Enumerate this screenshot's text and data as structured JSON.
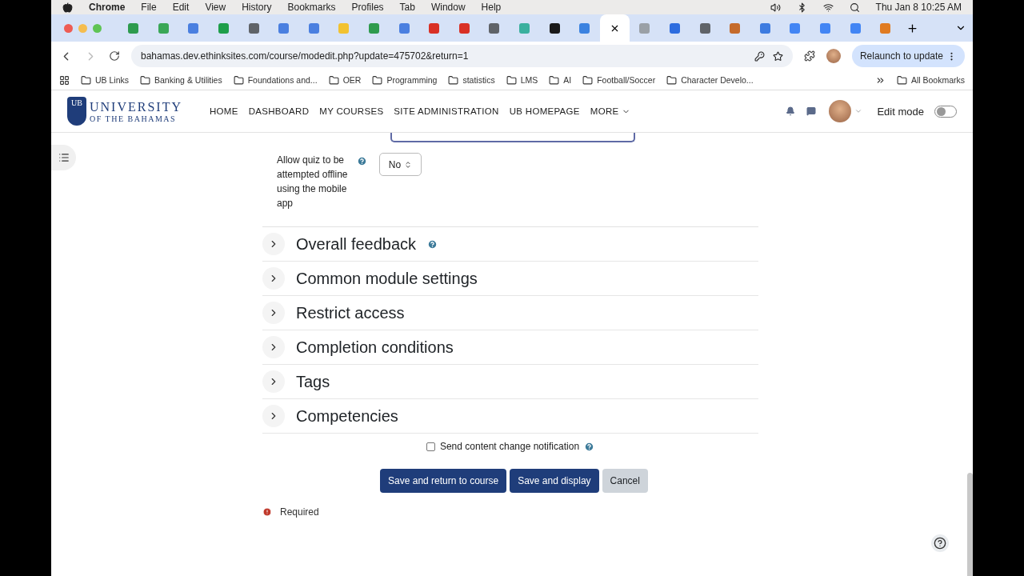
{
  "menu_bar": {
    "app": "Chrome",
    "items": [
      "File",
      "Edit",
      "View",
      "History",
      "Bookmarks",
      "Profiles",
      "Tab",
      "Window",
      "Help"
    ],
    "clock": "Thu Jan 8  10:25 AM"
  },
  "tabs": [
    {
      "selected": false,
      "color": "#2e9b4e"
    },
    {
      "selected": false,
      "color": "#3aa757"
    },
    {
      "selected": false,
      "color": "#4a7fe0"
    },
    {
      "selected": false,
      "color": "#1e9e4a"
    },
    {
      "selected": false,
      "color": "#5f6368"
    },
    {
      "selected": false,
      "color": "#4a7fe0"
    },
    {
      "selected": false,
      "color": "#4a7fe0"
    },
    {
      "selected": false,
      "color": "#f2c230"
    },
    {
      "selected": false,
      "color": "#2e9b4e"
    },
    {
      "selected": false,
      "color": "#4a7fe0"
    },
    {
      "selected": false,
      "color": "#d93025"
    },
    {
      "selected": false,
      "color": "#d93025"
    },
    {
      "selected": false,
      "color": "#5f6368"
    },
    {
      "selected": false,
      "color": "#3ab09e"
    },
    {
      "selected": false,
      "color": "#1a1a1a"
    },
    {
      "selected": false,
      "color": "#3b82e0"
    },
    {
      "selected": true
    },
    {
      "selected": false,
      "color": "#9aa0a6"
    },
    {
      "selected": false,
      "color": "#2d6cdf"
    },
    {
      "selected": false,
      "color": "#5f6368"
    },
    {
      "selected": false,
      "color": "#c56a2a"
    },
    {
      "selected": false,
      "color": "#3d7be0"
    },
    {
      "selected": false,
      "color": "#4285f4"
    },
    {
      "selected": false,
      "color": "#4285f4"
    },
    {
      "selected": false,
      "color": "#4285f4"
    },
    {
      "selected": false,
      "color": "#e07b22"
    }
  ],
  "address_bar": {
    "url": "bahamas.dev.ethinksites.com/course/modedit.php?update=475702&return=1",
    "relaunch": "Relaunch to update"
  },
  "bookmarks": [
    "UB Links",
    "Banking & Utilities",
    "Foundations and...",
    "OER",
    "Programming",
    "statistics",
    "LMS",
    "AI",
    "Football/Soccer",
    "Character Develo..."
  ],
  "all_bookmarks": "All Bookmarks",
  "site": {
    "logo_top": "UNIVERSITY",
    "logo_bottom": "OF THE BAHAMAS",
    "logo_badge": "UB",
    "nav": [
      "HOME",
      "DASHBOARD",
      "MY COURSES",
      "SITE ADMINISTRATION",
      "UB HOMEPAGE"
    ],
    "more": "MORE",
    "edit_mode": {
      "label": "Edit mode",
      "on": false
    }
  },
  "offline_setting": {
    "label": "Allow quiz to be attempted offline using the mobile app",
    "value": "No"
  },
  "sections": [
    {
      "title": "Overall feedback",
      "help": true,
      "expanded": false
    },
    {
      "title": "Common module settings",
      "expanded": false
    },
    {
      "title": "Restrict access",
      "expanded": false
    },
    {
      "title": "Completion conditions",
      "expanded": false
    },
    {
      "title": "Tags",
      "expanded": false
    },
    {
      "title": "Competencies",
      "expanded": false
    }
  ],
  "notification": {
    "label": "Send content change notification",
    "checked": false
  },
  "buttons": [
    {
      "label": "Save and return to course",
      "kind": "primary"
    },
    {
      "label": "Save and display",
      "kind": "primary"
    },
    {
      "label": "Cancel",
      "kind": "secondary"
    }
  ],
  "required_note": "Required"
}
